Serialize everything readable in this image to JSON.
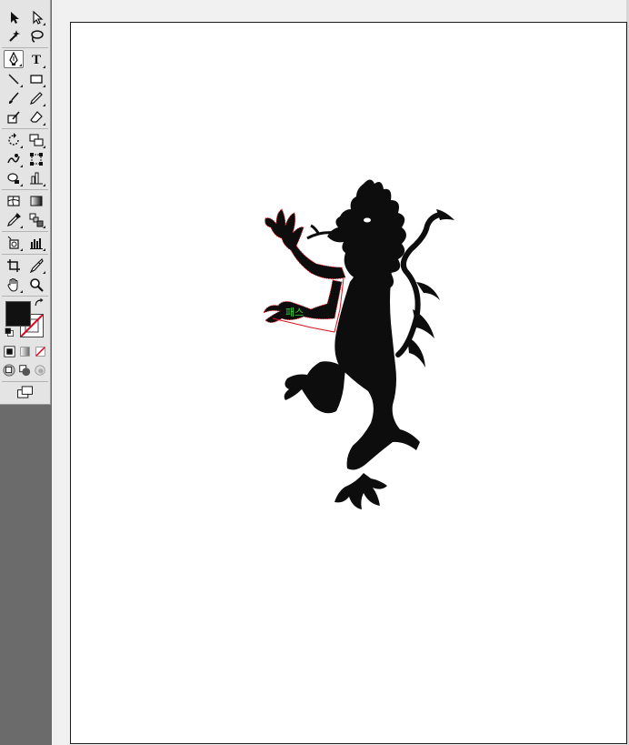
{
  "app": {
    "name": "Illustrator"
  },
  "toolbox": {
    "tools": [
      {
        "name": "selection-tool",
        "icon": "arrow-icon"
      },
      {
        "name": "direct-selection-tool",
        "icon": "hollow-arrow-icon"
      },
      {
        "name": "magic-wand-tool",
        "icon": "magic-wand-icon"
      },
      {
        "name": "lasso-tool",
        "icon": "lasso-icon"
      },
      {
        "name": "pen-tool",
        "icon": "pen-nib-icon",
        "active": true
      },
      {
        "name": "type-tool",
        "icon": "type-icon",
        "label": "T"
      },
      {
        "name": "line-segment-tool",
        "icon": "line-icon"
      },
      {
        "name": "rectangle-tool",
        "icon": "rectangle-icon"
      },
      {
        "name": "paintbrush-tool",
        "icon": "brush-icon"
      },
      {
        "name": "pencil-tool",
        "icon": "pencil-icon"
      },
      {
        "name": "blob-brush-tool",
        "icon": "blob-brush-icon"
      },
      {
        "name": "eraser-tool",
        "icon": "eraser-icon"
      },
      {
        "name": "rotate-tool",
        "icon": "rotate-icon"
      },
      {
        "name": "scale-tool",
        "icon": "scale-icon"
      },
      {
        "name": "warp-tool",
        "icon": "warp-icon"
      },
      {
        "name": "free-transform-tool",
        "icon": "free-transform-icon"
      },
      {
        "name": "symbol-sprayer-tool",
        "icon": "symbol-sprayer-icon"
      },
      {
        "name": "column-graph-tool",
        "icon": "column-graph-icon"
      },
      {
        "name": "mesh-tool",
        "icon": "mesh-icon"
      },
      {
        "name": "gradient-tool",
        "icon": "gradient-icon"
      },
      {
        "name": "eyedropper-tool",
        "icon": "eyedropper-icon"
      },
      {
        "name": "blend-tool",
        "icon": "blend-icon"
      },
      {
        "name": "symbol-tool",
        "icon": "symbol-icon"
      },
      {
        "name": "graph-tool",
        "icon": "bar-graph-icon"
      },
      {
        "name": "crop-area-tool",
        "icon": "crop-icon"
      },
      {
        "name": "slice-tool",
        "icon": "slice-icon"
      },
      {
        "name": "hand-tool",
        "icon": "hand-icon"
      },
      {
        "name": "zoom-tool",
        "icon": "magnifier-icon"
      }
    ],
    "fill_color": "#111111",
    "stroke_color": "none",
    "mode_buttons": [
      "color-mode-icon",
      "gradient-mode-icon",
      "none-mode-icon"
    ],
    "draw_modes": [
      "draw-normal-icon",
      "draw-behind-icon",
      "draw-inside-icon"
    ],
    "screen_mode": "screen-mode-icon"
  },
  "canvas": {
    "artwork": "rampant-lion-silhouette",
    "selection_color": "#d9141f",
    "cursor_label": "패스"
  }
}
